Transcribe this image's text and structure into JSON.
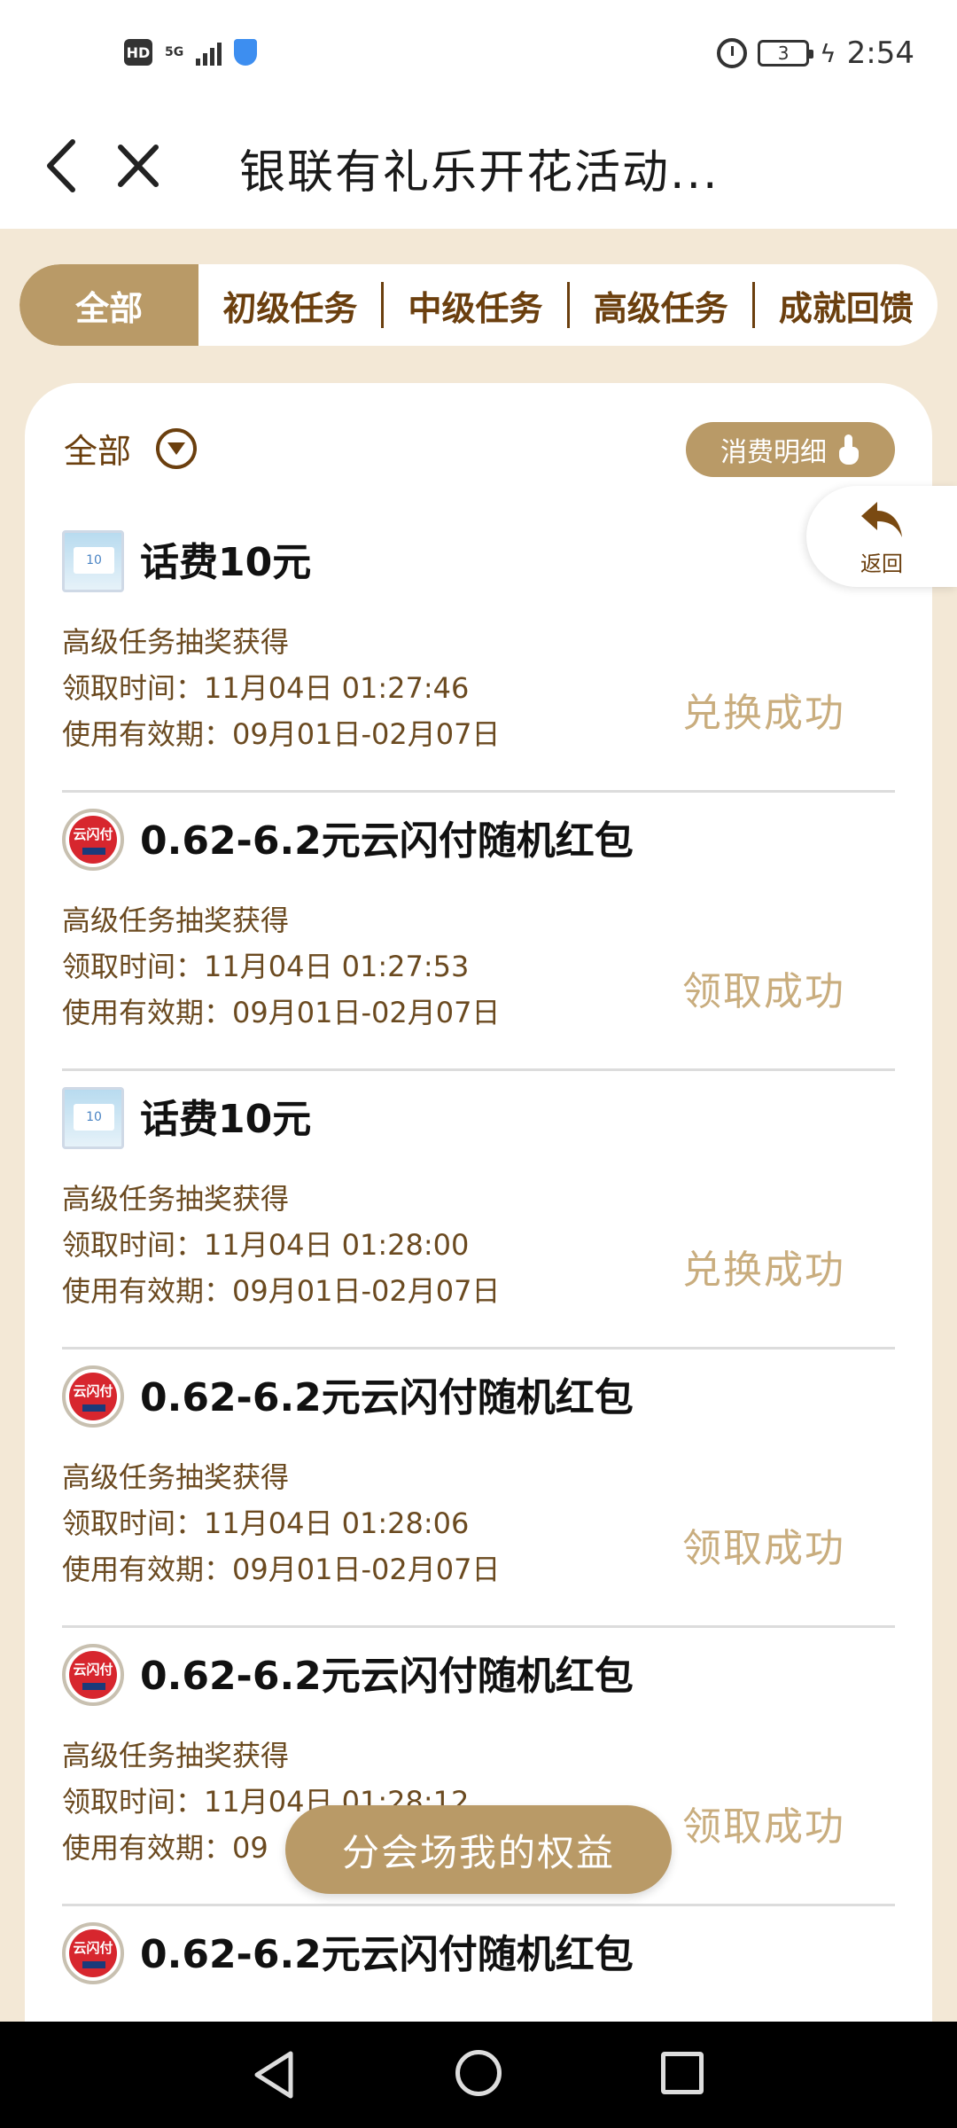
{
  "status_bar": {
    "hd": "HD",
    "network": "5G",
    "battery_level": "3",
    "time": "2:54"
  },
  "header": {
    "title": "银联有礼乐开花活动..."
  },
  "tabs": [
    {
      "label": "全部",
      "active": true
    },
    {
      "label": "初级任务",
      "active": false
    },
    {
      "label": "中级任务",
      "active": false
    },
    {
      "label": "高级任务",
      "active": false
    },
    {
      "label": "成就回馈",
      "active": false
    }
  ],
  "filter": {
    "label": "全部",
    "detail_button": "消费明细"
  },
  "return_button": {
    "label": "返回"
  },
  "records": [
    {
      "icon": "phone-credit-icon",
      "title": "话费10元",
      "source": "高级任务抽奖获得",
      "claim_time": "领取时间：11月04日 01:27:46",
      "validity": "使用有效期：09月01日-02月07日",
      "status": "兑换成功"
    },
    {
      "icon": "unionpay-icon",
      "title": "0.62-6.2元云闪付随机红包",
      "source": "高级任务抽奖获得",
      "claim_time": "领取时间：11月04日 01:27:53",
      "validity": "使用有效期：09月01日-02月07日",
      "status": "领取成功"
    },
    {
      "icon": "phone-credit-icon",
      "title": "话费10元",
      "source": "高级任务抽奖获得",
      "claim_time": "领取时间：11月04日 01:28:00",
      "validity": "使用有效期：09月01日-02月07日",
      "status": "兑换成功"
    },
    {
      "icon": "unionpay-icon",
      "title": "0.62-6.2元云闪付随机红包",
      "source": "高级任务抽奖获得",
      "claim_time": "领取时间：11月04日 01:28:06",
      "validity": "使用有效期：09月01日-02月07日",
      "status": "领取成功"
    },
    {
      "icon": "unionpay-icon",
      "title": "0.62-6.2元云闪付随机红包",
      "source": "高级任务抽奖获得",
      "claim_time": "领取时间：11月04日 01:28:12",
      "validity": "使用有效期：09",
      "status": "领取成功"
    },
    {
      "icon": "unionpay-icon",
      "title": "0.62-6.2元云闪付随机红包"
    }
  ],
  "float_button": {
    "label": "分会场我的权益"
  },
  "icon_text": {
    "phone_card": "10",
    "yun": "云闪付"
  },
  "colors": {
    "accent": "#b99a67",
    "brown_text": "#6b3f0e",
    "status_text": "#c9ad7e",
    "page_bg": "#f3e8d6"
  }
}
